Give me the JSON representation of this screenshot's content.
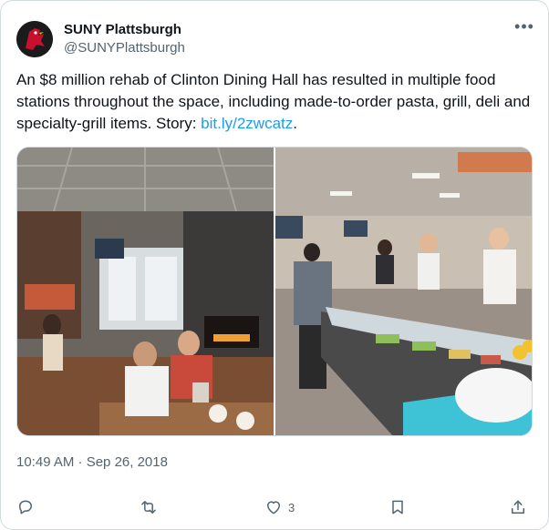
{
  "author": {
    "name": "SUNY Plattsburgh",
    "handle": "@SUNYPlattsburgh",
    "avatar_icon": "cardinal-mascot-logo",
    "brand_color": "#c8102e"
  },
  "more_icon": "more-dots-icon",
  "tweet": {
    "text_before_link": "An $8 million rehab of Clinton Dining Hall has resulted in multiple food stations throughout the space, including made-to-order pasta, grill, deli and specialty-grill items. Story: ",
    "link_text": "bit.ly/2zwcatz",
    "text_after_link": ".",
    "link_color": "#1d9bf0"
  },
  "media": {
    "photos": [
      {
        "subject": "dining-hall-seating-photo"
      },
      {
        "subject": "food-station-serving-line-photo"
      }
    ]
  },
  "timestamp": "10:49 AM · Sep 26, 2018",
  "actions": {
    "reply": {
      "icon": "reply-icon"
    },
    "retweet": {
      "icon": "retweet-icon"
    },
    "like": {
      "icon": "heart-icon",
      "count": "3"
    },
    "bookmark": {
      "icon": "bookmark-icon"
    },
    "share": {
      "icon": "share-icon"
    }
  }
}
